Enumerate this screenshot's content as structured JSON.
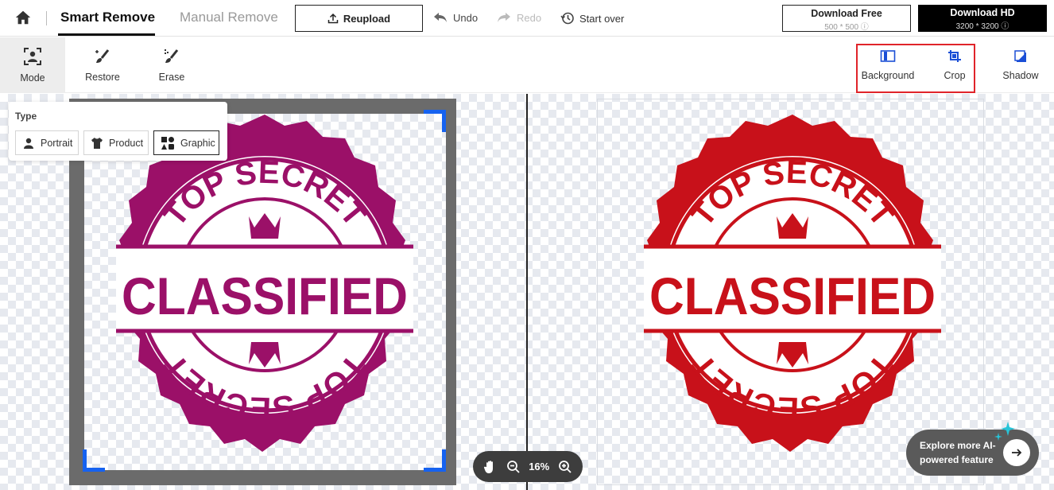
{
  "header": {
    "tabs": [
      "Smart Remove",
      "Manual Remove"
    ],
    "reupload_label": "Reupload",
    "undo_label": "Undo",
    "redo_label": "Redo",
    "start_over_label": "Start over",
    "download_free": {
      "title": "Download Free",
      "size": "500 * 500"
    },
    "download_hd": {
      "title": "Download HD",
      "size": "3200 * 3200"
    }
  },
  "toolbar": {
    "mode_label": "Mode",
    "restore_label": "Restore",
    "erase_label": "Erase",
    "background_label": "Background",
    "crop_label": "Crop",
    "shadow_label": "Shadow"
  },
  "type_panel": {
    "label": "Type",
    "options": [
      "Portrait",
      "Product",
      "Graphic"
    ],
    "selected": "Graphic"
  },
  "stamp": {
    "top_text": "TOP SECRET",
    "center_text": "CLASSIFIED",
    "bottom_text": "TOP SECRET",
    "original_color": "#9b1068",
    "result_color": "#c8111a"
  },
  "zoom": {
    "level": "16%"
  },
  "explore": {
    "text": "Explore more AI-powered feature"
  },
  "colors": {
    "accent_blue": "#1662f0",
    "highlight_red": "#e0242a"
  }
}
